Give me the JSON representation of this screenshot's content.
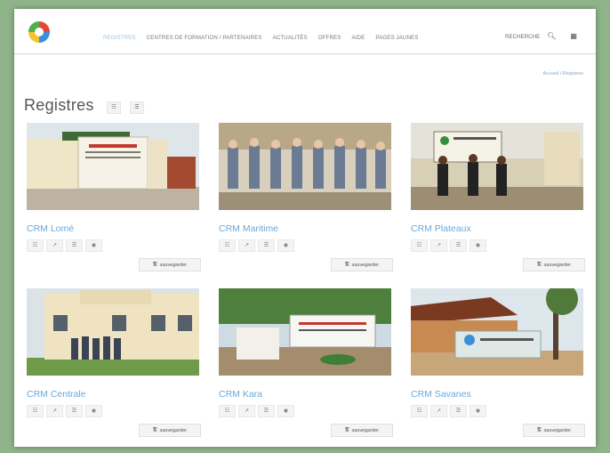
{
  "nav": {
    "links": [
      "REGISTRES",
      "CENTRES DE FORMATION / PARTENAIRES",
      "ACTUALITÉS",
      "OFFRES",
      "AIDE",
      "PAGES JAUNES"
    ],
    "search_label": "RECHERCHE"
  },
  "breadcrumb": "Accueil / Registres",
  "page": {
    "title": "Registres"
  },
  "cards": [
    {
      "name": "CRM Lomé",
      "save_label": "sauvegarder"
    },
    {
      "name": "CRM Maritime",
      "save_label": "sauvegarder"
    },
    {
      "name": "CRM Plateaux",
      "save_label": "sauvegarder"
    },
    {
      "name": "CRM Centrale",
      "save_label": "sauvegarder"
    },
    {
      "name": "CRM Kara",
      "save_label": "sauvegarder"
    },
    {
      "name": "CRM Savanes",
      "save_label": "sauvegarder"
    }
  ],
  "card_icons": [
    "users-icon",
    "thumb-icon",
    "list-icon",
    "map-marker-icon"
  ],
  "colors": {
    "accent": "#6aa9d8",
    "nav_line": "#bfe0e3",
    "frame_bg": "#8fb48a"
  }
}
